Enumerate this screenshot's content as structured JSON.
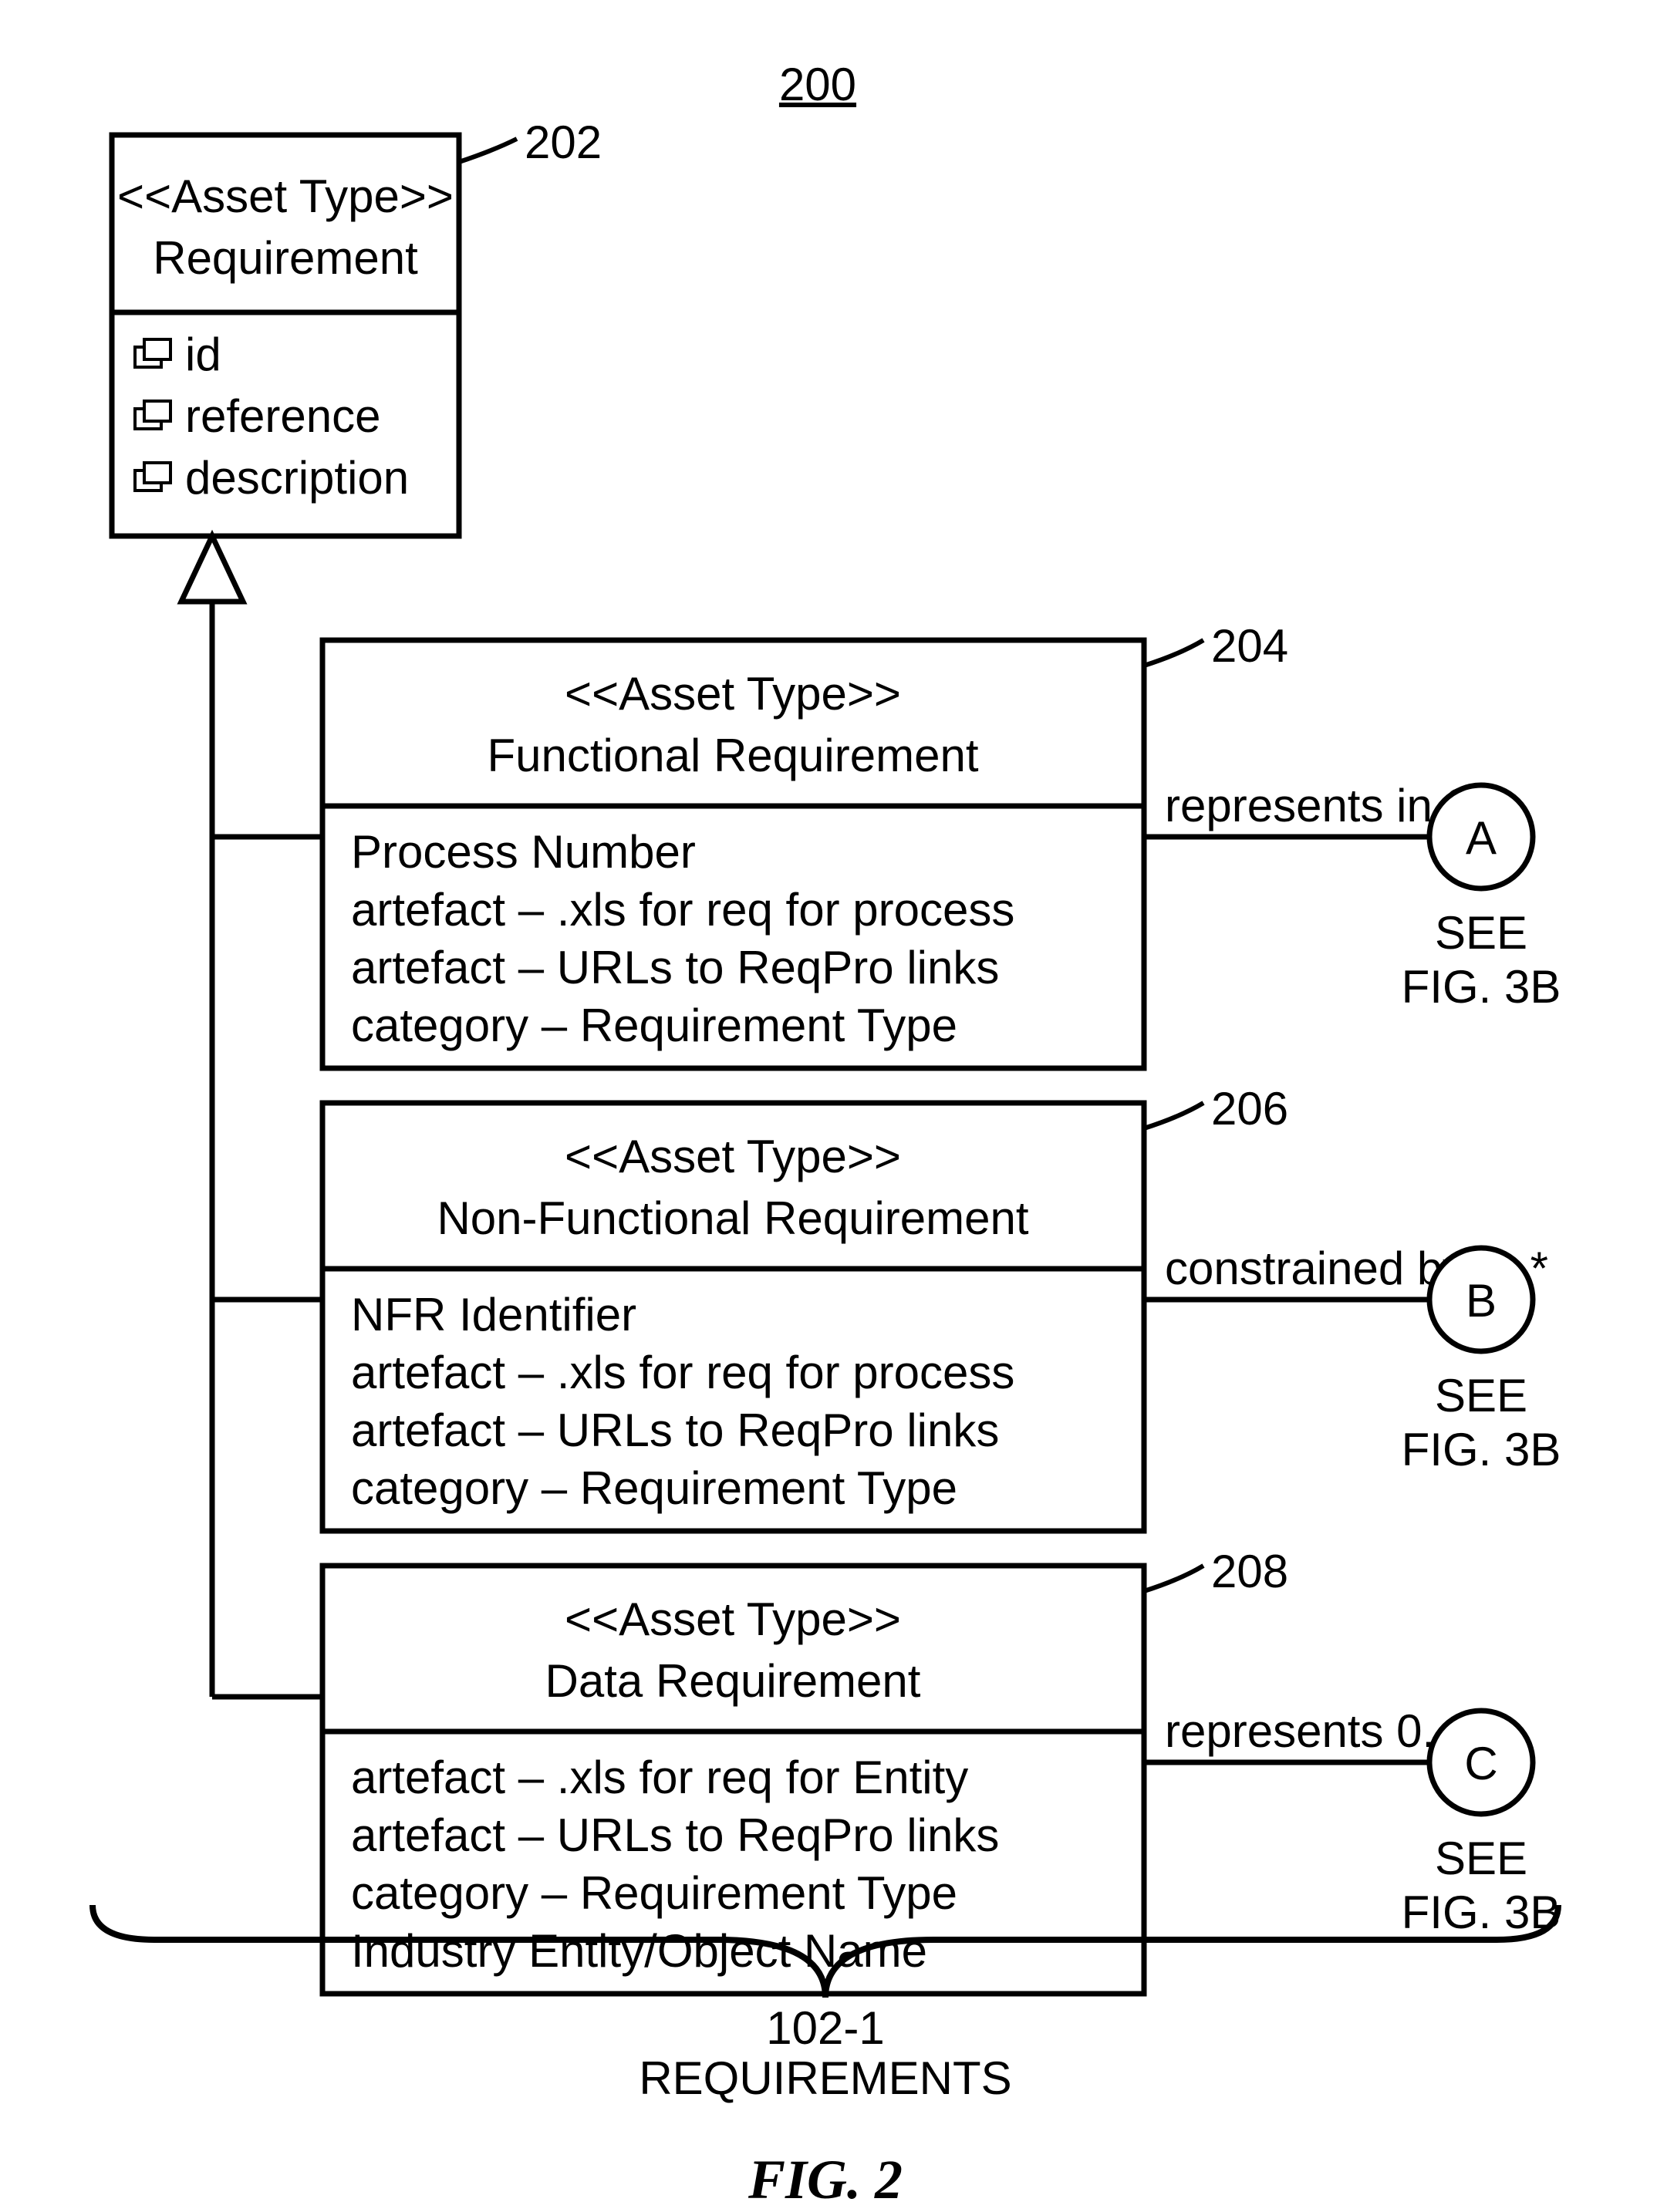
{
  "fig_number_top": "200",
  "parent": {
    "refnum": "202",
    "stereotype": "<<Asset Type>>",
    "name": "Requirement",
    "attrs": [
      "id",
      "reference",
      "description"
    ]
  },
  "children": [
    {
      "refnum": "204",
      "stereotype": "<<Asset Type>>",
      "name": "Functional Requirement",
      "attrs": [
        "Process Number",
        "artefact – .xls for req for process",
        "artefact – URLs to ReqPro links",
        "category – Requirement Type"
      ],
      "assoc_label": "represents in 0..*",
      "conn_letter": "A",
      "conn_below": [
        "SEE",
        "FIG. 3B"
      ]
    },
    {
      "refnum": "206",
      "stereotype": "<<Asset Type>>",
      "name": "Non-Functional Requirement",
      "attrs": [
        "NFR Identifier",
        "artefact – .xls for req for process",
        "artefact – URLs to ReqPro links",
        "category – Requirement Type"
      ],
      "assoc_label": "constrained by 0..*",
      "conn_letter": "B",
      "conn_below": [
        "SEE",
        "FIG. 3B"
      ]
    },
    {
      "refnum": "208",
      "stereotype": "<<Asset Type>>",
      "name": "Data Requirement",
      "attrs": [
        "artefact – .xls for req for Entity",
        "artefact – URLs to ReqPro links",
        "category – Requirement Type",
        "Industry Entity/Object Name"
      ],
      "assoc_label": "represents 0..*",
      "conn_letter": "C",
      "conn_below": [
        "SEE",
        "FIG. 3B"
      ]
    }
  ],
  "brace_label_top": "102-1",
  "brace_label_bottom": "REQUIREMENTS",
  "figure_title": "FIG. 2"
}
